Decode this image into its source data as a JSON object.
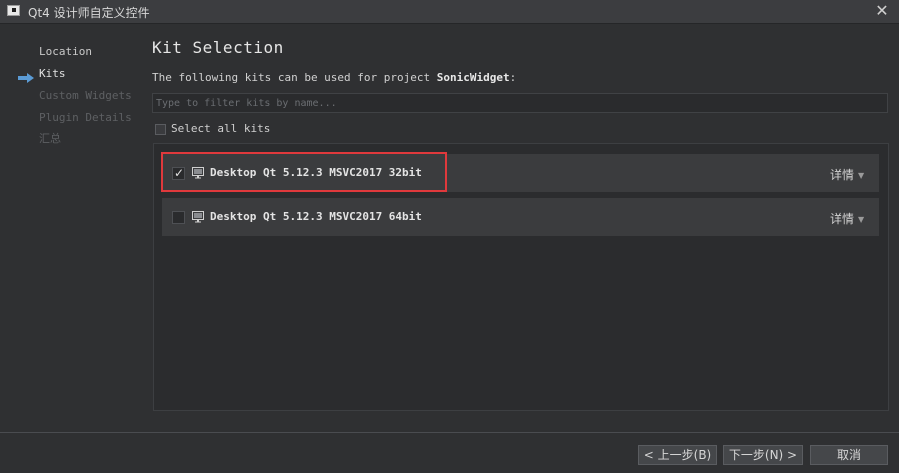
{
  "window": {
    "title": "Qt4 设计师自定义控件",
    "close_glyph": "✕"
  },
  "sidebar": {
    "items": [
      {
        "label": "Location",
        "state": "done"
      },
      {
        "label": "Kits",
        "state": "current"
      },
      {
        "label": "Custom Widgets",
        "state": "pending"
      },
      {
        "label": "Plugin Details",
        "state": "pending"
      },
      {
        "label": "汇总",
        "state": "pending"
      }
    ]
  },
  "main": {
    "title": "Kit Selection",
    "description_prefix": "The following kits can be used for project ",
    "project_name": "SonicWidget",
    "description_suffix": ":",
    "filter_placeholder": "Type to filter kits by name...",
    "filter_value": "",
    "select_all_label": "Select all kits",
    "select_all_checked": false,
    "kits": [
      {
        "name": "Desktop Qt 5.12.3 MSVC2017 32bit",
        "checked": true,
        "details_label": "详情",
        "icon": "monitor-icon"
      },
      {
        "name": "Desktop Qt 5.12.3 MSVC2017 64bit",
        "checked": false,
        "details_label": "详情",
        "icon": "monitor-icon"
      }
    ]
  },
  "footer": {
    "back_label": "< 上一步(B)",
    "next_label": "下一步(N) >",
    "cancel_label": "取消"
  },
  "colors": {
    "background": "#2f3032",
    "highlight": "#e0393c",
    "arrow": "#5b9bd5"
  }
}
